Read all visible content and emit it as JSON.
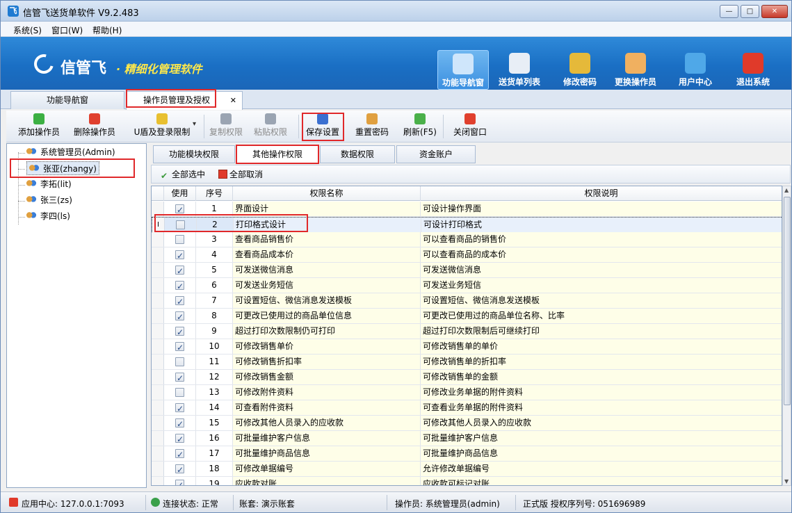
{
  "window": {
    "title": "信管飞送货单软件 V9.2.483",
    "min_label": "—",
    "max_label": "□",
    "close_label": "✕"
  },
  "menu": [
    "系统(S)",
    "窗口(W)",
    "帮助(H)"
  ],
  "banner": {
    "logo": "信管飞",
    "slogan": "· 精细化管理软件"
  },
  "nav": [
    {
      "label": "功能导航窗",
      "icon": "monitor-icon",
      "color": "#cfe6fb"
    },
    {
      "label": "送货单列表",
      "icon": "list-icon",
      "color": "#e8eef6"
    },
    {
      "label": "修改密码",
      "icon": "lock-icon",
      "color": "#e5b93a"
    },
    {
      "label": "更换操作员",
      "icon": "user-icon",
      "color": "#f0b060"
    },
    {
      "label": "用户中心",
      "icon": "globe-icon",
      "color": "#4fa8e8"
    },
    {
      "label": "退出系统",
      "icon": "power-icon",
      "color": "#e03a2a"
    }
  ],
  "main_tabs": [
    "功能导航窗",
    "操作员管理及授权"
  ],
  "tab_close": "✕",
  "toolbar": [
    {
      "label": "添加操作员",
      "color": "#3cb043",
      "enabled": true
    },
    {
      "label": "删除操作员",
      "color": "#e0402e",
      "enabled": true
    },
    {
      "label": "U盾及登录限制",
      "color": "#e8c030",
      "enabled": true
    },
    {
      "label": "复制权限",
      "color": "#9aa4b2",
      "enabled": false
    },
    {
      "label": "粘贴权限",
      "color": "#9aa4b2",
      "enabled": false
    },
    {
      "label": "保存设置",
      "color": "#3a6fd0",
      "enabled": true
    },
    {
      "label": "重置密码",
      "color": "#e0a040",
      "enabled": true
    },
    {
      "label": "刷新(F5)",
      "color": "#4ab04a",
      "enabled": true
    },
    {
      "label": "关闭窗口",
      "color": "#e0402e",
      "enabled": true
    }
  ],
  "toolbar_dropdown": "▾",
  "users": [
    "系统管理员(Admin)",
    "张亚(zhangy)",
    "李拓(lit)",
    "张三(zs)",
    "李四(ls)"
  ],
  "sub_tabs": [
    "功能模块权限",
    "其他操作权限",
    "数据权限",
    "资金账户"
  ],
  "sub_toolbar": {
    "select_all": "全部选中",
    "deselect_all": "全部取消"
  },
  "grid": {
    "headers": [
      "使用",
      "序号",
      "权限名称",
      "权限说明"
    ],
    "rows": [
      {
        "checked": true,
        "no": "1",
        "name": "界面设计",
        "desc": "可设计操作界面"
      },
      {
        "checked": false,
        "no": "2",
        "name": "打印格式设计",
        "desc": "可设计打印格式",
        "selected": true
      },
      {
        "checked": false,
        "no": "3",
        "name": "查看商品销售价",
        "desc": "可以查看商品的销售价"
      },
      {
        "checked": true,
        "no": "4",
        "name": "查看商品成本价",
        "desc": "可以查看商品的成本价"
      },
      {
        "checked": true,
        "no": "5",
        "name": "可发送微信消息",
        "desc": "可发送微信消息"
      },
      {
        "checked": true,
        "no": "6",
        "name": "可发送业务短信",
        "desc": "可发送业务短信"
      },
      {
        "checked": true,
        "no": "7",
        "name": "可设置短信、微信消息发送模板",
        "desc": "可设置短信、微信消息发送模板"
      },
      {
        "checked": true,
        "no": "8",
        "name": "可更改已使用过的商品单位信息",
        "desc": "可更改已使用过的商品单位名称、比率"
      },
      {
        "checked": true,
        "no": "9",
        "name": "超过打印次数限制仍可打印",
        "desc": "超过打印次数限制后可继续打印"
      },
      {
        "checked": true,
        "no": "10",
        "name": "可修改销售单价",
        "desc": "可修改销售单的单价"
      },
      {
        "checked": false,
        "no": "11",
        "name": "可修改销售折扣率",
        "desc": "可修改销售单的折扣率"
      },
      {
        "checked": true,
        "no": "12",
        "name": "可修改销售金额",
        "desc": "可修改销售单的金额"
      },
      {
        "checked": false,
        "no": "13",
        "name": "可修改附件资料",
        "desc": "可修改业务单据的附件资料"
      },
      {
        "checked": true,
        "no": "14",
        "name": "可查看附件资料",
        "desc": "可查看业务单据的附件资料"
      },
      {
        "checked": true,
        "no": "15",
        "name": "可修改其他人员录入的应收款",
        "desc": "可修改其他人员录入的应收款"
      },
      {
        "checked": true,
        "no": "16",
        "name": "可批量维护客户信息",
        "desc": "可批量维护客户信息"
      },
      {
        "checked": true,
        "no": "17",
        "name": "可批量维护商品信息",
        "desc": "可批量维护商品信息"
      },
      {
        "checked": true,
        "no": "18",
        "name": "可修改单据编号",
        "desc": "允许修改单据编号"
      },
      {
        "checked": true,
        "no": "19",
        "name": "应收款对账",
        "desc": "应收款可标记对账"
      }
    ],
    "row_marker": "I"
  },
  "status": {
    "app_center": "应用中心: 127.0.0.1:7093",
    "connection": "连接状态: 正常",
    "account": "账套: 演示账套",
    "operator": "操作员: 系统管理员(admin)",
    "license": "正式版 授权序列号: 051696989"
  }
}
